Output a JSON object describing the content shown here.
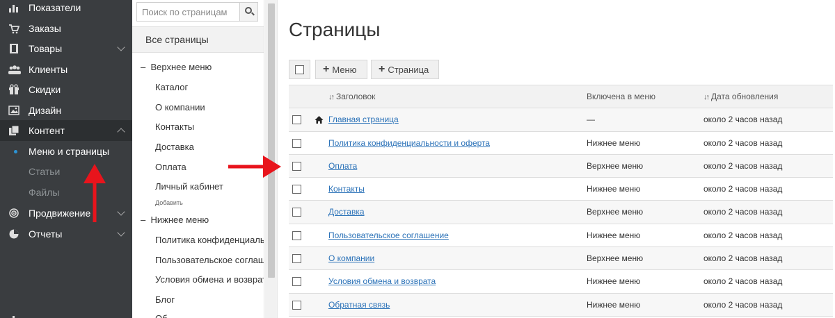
{
  "nav": {
    "items": [
      {
        "label": "Показатели",
        "icon": "bar-chart-icon",
        "chevron": false
      },
      {
        "label": "Заказы",
        "icon": "cart-icon",
        "chevron": false
      },
      {
        "label": "Товары",
        "icon": "book-icon",
        "chevron": true
      },
      {
        "label": "Клиенты",
        "icon": "users-icon",
        "chevron": false
      },
      {
        "label": "Скидки",
        "icon": "gift-icon",
        "chevron": false
      },
      {
        "label": "Дизайн",
        "icon": "image-icon",
        "chevron": false
      },
      {
        "label": "Контент",
        "icon": "copy-icon",
        "chevron": true
      },
      {
        "label": "Продвижение",
        "icon": "target-icon",
        "chevron": true
      },
      {
        "label": "Отчеты",
        "icon": "pie-chart-icon",
        "chevron": true
      }
    ],
    "sub_items": [
      "Меню и страницы",
      "Статьи",
      "Файлы"
    ],
    "active_sub": "Меню и страницы"
  },
  "tree": {
    "search_placeholder": "Поиск по страницам",
    "all_pages": "Все страницы",
    "top_menu": {
      "label": "Верхнее меню",
      "items": [
        "Каталог",
        "О компании",
        "Контакты",
        "Доставка",
        "Оплата",
        "Личный кабинет"
      ],
      "add_label": "Добавить"
    },
    "bottom_menu": {
      "label": "Нижнее меню",
      "items": [
        "Политика конфиденциальнос",
        "Пользовательское соглашени",
        "Условия обмена и возврата",
        "Блог",
        "Об"
      ]
    }
  },
  "main": {
    "title": "Страницы",
    "toolbar": {
      "menu_label": "Меню",
      "page_label": "Страница"
    },
    "columns": {
      "title": "Заголовок",
      "in_menu": "Включена в меню",
      "updated": "Дата обновления"
    },
    "rows": [
      {
        "title": "Главная страница",
        "menu": "—",
        "updated": "около 2 часов назад",
        "home": true
      },
      {
        "title": "Политика конфиденциальности и оферта",
        "menu": "Нижнее меню",
        "updated": "около 2 часов назад",
        "home": false
      },
      {
        "title": "Оплата",
        "menu": "Верхнее меню",
        "updated": "около 2 часов назад",
        "home": false
      },
      {
        "title": "Контакты",
        "menu": "Нижнее меню",
        "updated": "около 2 часов назад",
        "home": false
      },
      {
        "title": "Доставка",
        "menu": "Верхнее меню",
        "updated": "около 2 часов назад",
        "home": false
      },
      {
        "title": "Пользовательское соглашение",
        "menu": "Нижнее меню",
        "updated": "около 2 часов назад",
        "home": false
      },
      {
        "title": "О компании",
        "menu": "Верхнее меню",
        "updated": "около 2 часов назад",
        "home": false
      },
      {
        "title": "Условия обмена и возврата",
        "menu": "Нижнее меню",
        "updated": "около 2 часов назад",
        "home": false
      },
      {
        "title": "Обратная связь",
        "menu": "Нижнее меню",
        "updated": "около 2 часов назад",
        "home": false
      }
    ]
  },
  "colors": {
    "sidebar_bg": "#3a3d40",
    "link": "#2b72b8",
    "annotation_arrow": "#e8141c"
  }
}
